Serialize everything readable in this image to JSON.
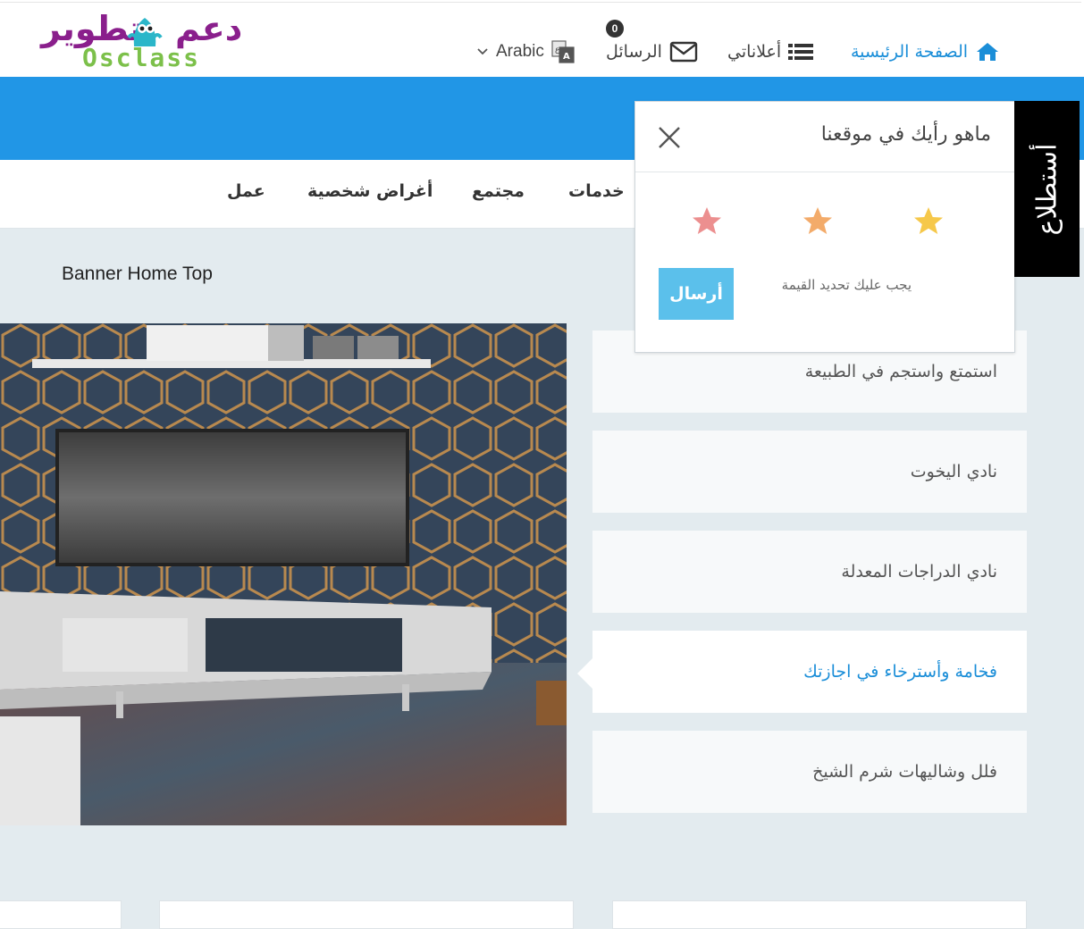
{
  "logo": {
    "arabic_left": "تطوير",
    "arabic_right": "دعم",
    "english": "Osclass"
  },
  "nav": {
    "home": "الصفحة الرئيسية",
    "my_ads": "أعلاناتي",
    "messages": "الرسائل",
    "messages_count": "0",
    "language": "Arabic"
  },
  "categories": [
    "خدمات",
    "مجتمع",
    "أغراض شخصية",
    "عمل"
  ],
  "banner": {
    "label": "Banner Home Top"
  },
  "side_list": [
    "استمتع واستجم في الطبيعة",
    "نادي اليخوت",
    "نادي الدراجات المعدلة",
    "فخامة وأسترخاء في اجازتك",
    "فلل وشاليهات شرم الشيخ"
  ],
  "popup": {
    "title": "ماهو رأيك في موقعنا",
    "hint": "يجب عليك تحديد القيمة",
    "send": "أرسال",
    "star_colors": [
      "#f6c84a",
      "#f3ab6a",
      "#ec8f8f"
    ]
  },
  "survey_tab": "أستطلاع",
  "colors": {
    "accent": "#2196e6",
    "link": "#1b8ed8",
    "send": "#5bc0eb"
  }
}
